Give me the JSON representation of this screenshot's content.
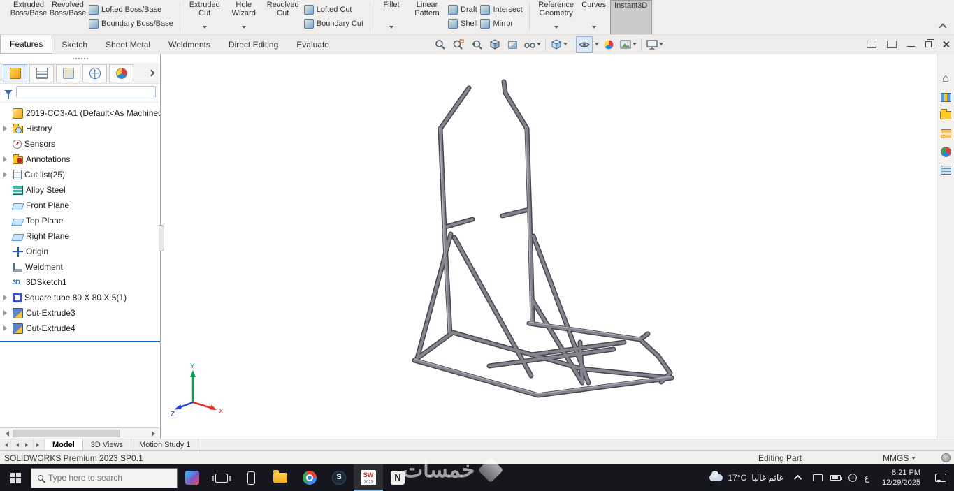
{
  "ribbon": {
    "groups": [
      {
        "large": [
          "Extruded Boss/Base",
          "Revolved Boss/Base"
        ],
        "small": [
          "Lofted Boss/Base",
          "Boundary Boss/Base"
        ]
      },
      {
        "large": [
          "Extruded Cut",
          "Hole Wizard",
          "Revolved Cut"
        ],
        "small": [
          "Lofted Cut",
          "Boundary Cut"
        ]
      },
      {
        "large": [
          "Fillet",
          "Linear Pattern"
        ],
        "small": [
          "Draft",
          "Shell",
          "Intersect",
          "Mirror"
        ]
      },
      {
        "large": [
          "Reference Geometry",
          "Curves",
          "Instant3D"
        ]
      }
    ]
  },
  "tabs": [
    "Features",
    "Sketch",
    "Sheet Metal",
    "Weldments",
    "Direct Editing",
    "Evaluate"
  ],
  "feature_tree": {
    "root": "2019-CO3-A1 (Default<As Machined>",
    "items": [
      {
        "label": "History"
      },
      {
        "label": "Sensors"
      },
      {
        "label": "Annotations"
      },
      {
        "label": "Cut list(25)"
      },
      {
        "label": "Alloy Steel"
      },
      {
        "label": "Front Plane"
      },
      {
        "label": "Top Plane"
      },
      {
        "label": "Right Plane"
      },
      {
        "label": "Origin"
      },
      {
        "label": "Weldment"
      },
      {
        "label": "3DSketch1"
      },
      {
        "label": "Square tube 80 X 80 X 5(1)"
      },
      {
        "label": "Cut-Extrude3"
      },
      {
        "label": "Cut-Extrude4"
      }
    ]
  },
  "triad": {
    "x": "X",
    "y": "Y",
    "z": "Z"
  },
  "doc_tabs": [
    "Model",
    "3D Views",
    "Motion Study 1"
  ],
  "status_bar": {
    "app": "SOLIDWORKS Premium 2023 SP0.1",
    "mode": "Editing Part",
    "units": "MMGS"
  },
  "taskbar": {
    "search_placeholder": "Type here to search",
    "weather_temp": "17°C",
    "weather_text": "غائم غالبا",
    "language_indicator": "ع",
    "time": "8:21 PM",
    "date": "12/29/2025",
    "watermark": "خمسات"
  }
}
